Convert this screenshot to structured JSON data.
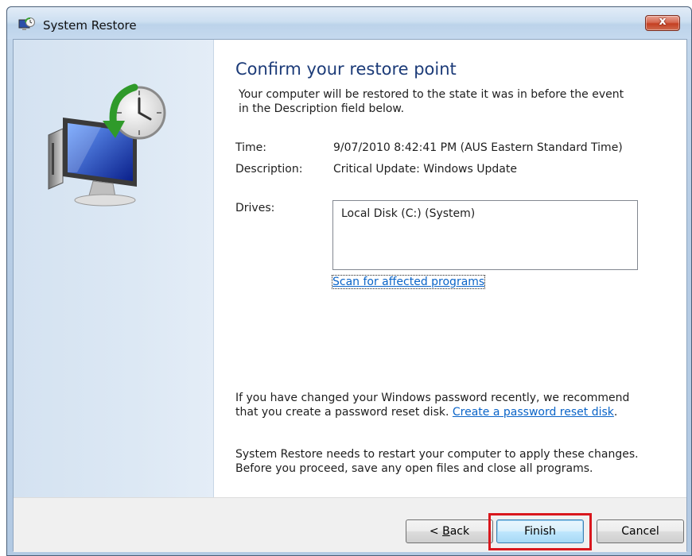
{
  "window": {
    "title": "System Restore",
    "close_label": "x"
  },
  "icons": {
    "title": "system-restore-icon",
    "hero": "computer-with-restore-clock-icon"
  },
  "main": {
    "heading": "Confirm your restore point",
    "intro_line1": "Your computer will be restored to the state it was in before the event",
    "intro_line2": "in the Description field below.",
    "time_label": "Time:",
    "time_value": "9/07/2010 8:42:41 PM (AUS Eastern Standard Time)",
    "description_label": "Description:",
    "description_value": "Critical Update: Windows Update",
    "drives_label": "Drives:",
    "drives": [
      "Local Disk (C:) (System)"
    ],
    "scan_link": "Scan for affected programs",
    "password_note_line1": "If you have changed your Windows password recently, we recommend",
    "password_note_line2": "that you create a password reset disk.",
    "password_link": "Create a password reset disk",
    "password_note_end": ".",
    "restart_note_line1": "System Restore needs to restart your computer to apply these changes.",
    "restart_note_line2": "Before you proceed, save any open files and close all programs."
  },
  "footer": {
    "back_mnemonic": "B",
    "back_rest": "ack",
    "back_prefix": "< ",
    "finish_label": "Finish",
    "cancel_label": "Cancel"
  },
  "colors": {
    "heading": "#1c3b78",
    "link": "#0a64c8",
    "highlight": "#d9171d"
  }
}
